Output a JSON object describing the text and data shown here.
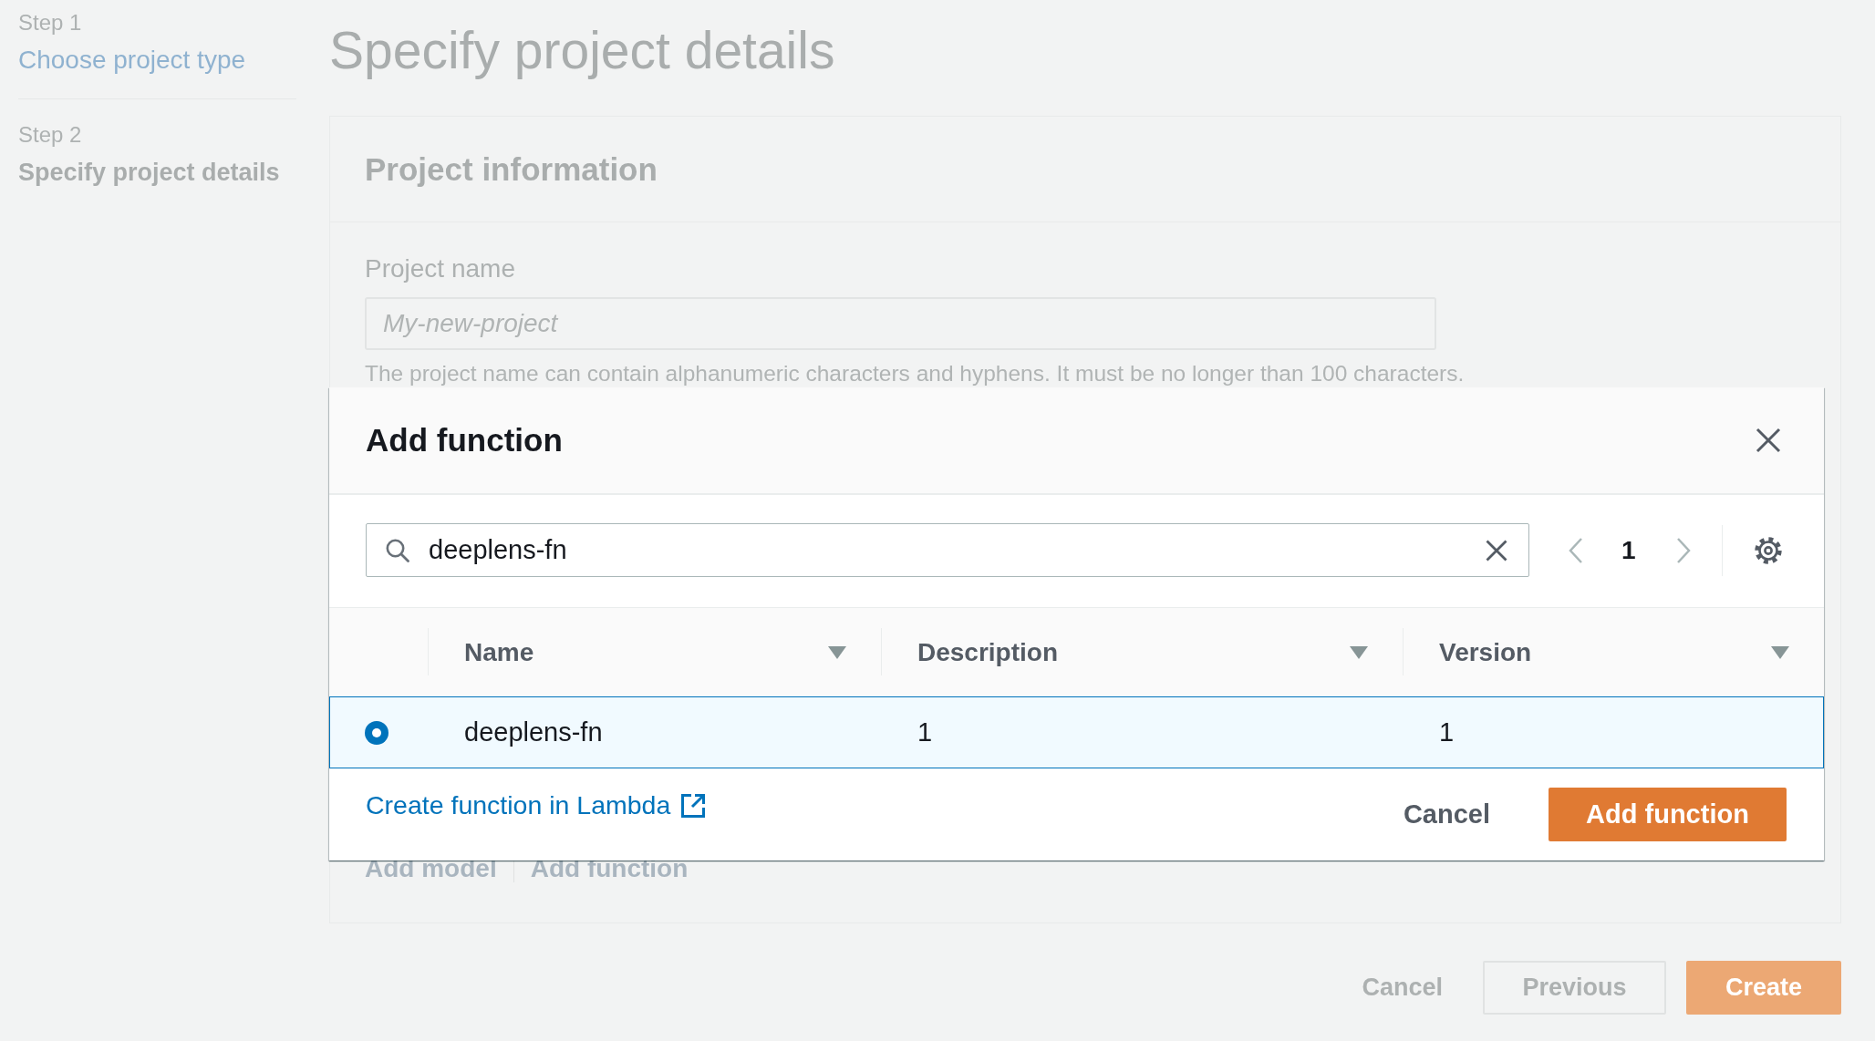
{
  "steps": [
    {
      "step": "Step 1",
      "label": "Choose project type",
      "selected": false
    },
    {
      "step": "Step 2",
      "label": "Specify project details",
      "selected": true
    }
  ],
  "page_title": "Specify project details",
  "panel": {
    "title": "Project information",
    "field": {
      "label": "Project name",
      "placeholder": "My-new-project",
      "help": "The project name can contain alphanumeric characters and hyphens. It must be no longer than 100 characters."
    },
    "actions": [
      "Add model",
      "Add function"
    ]
  },
  "footer_buttons": [
    {
      "label": "Cancel",
      "kind": "link"
    },
    {
      "label": "Previous",
      "kind": "normal"
    },
    {
      "label": "Create",
      "kind": "primary"
    }
  ],
  "modal": {
    "title": "Add function",
    "search": {
      "value": "deeplens-fn"
    },
    "pagination": {
      "previous": {
        "disabled": true
      },
      "page": "1",
      "next": {
        "disabled": true
      }
    },
    "columns": [
      {
        "label": "Name"
      },
      {
        "label": "Description"
      },
      {
        "label": "Version"
      }
    ],
    "rows": [
      {
        "selected": true,
        "cells": [
          "deeplens-fn",
          "1",
          "1"
        ]
      }
    ],
    "link": "Create function in Lambda",
    "buttons": [
      {
        "label": "Cancel",
        "kind": "link"
      },
      {
        "label": "Add function",
        "kind": "primary"
      }
    ]
  }
}
